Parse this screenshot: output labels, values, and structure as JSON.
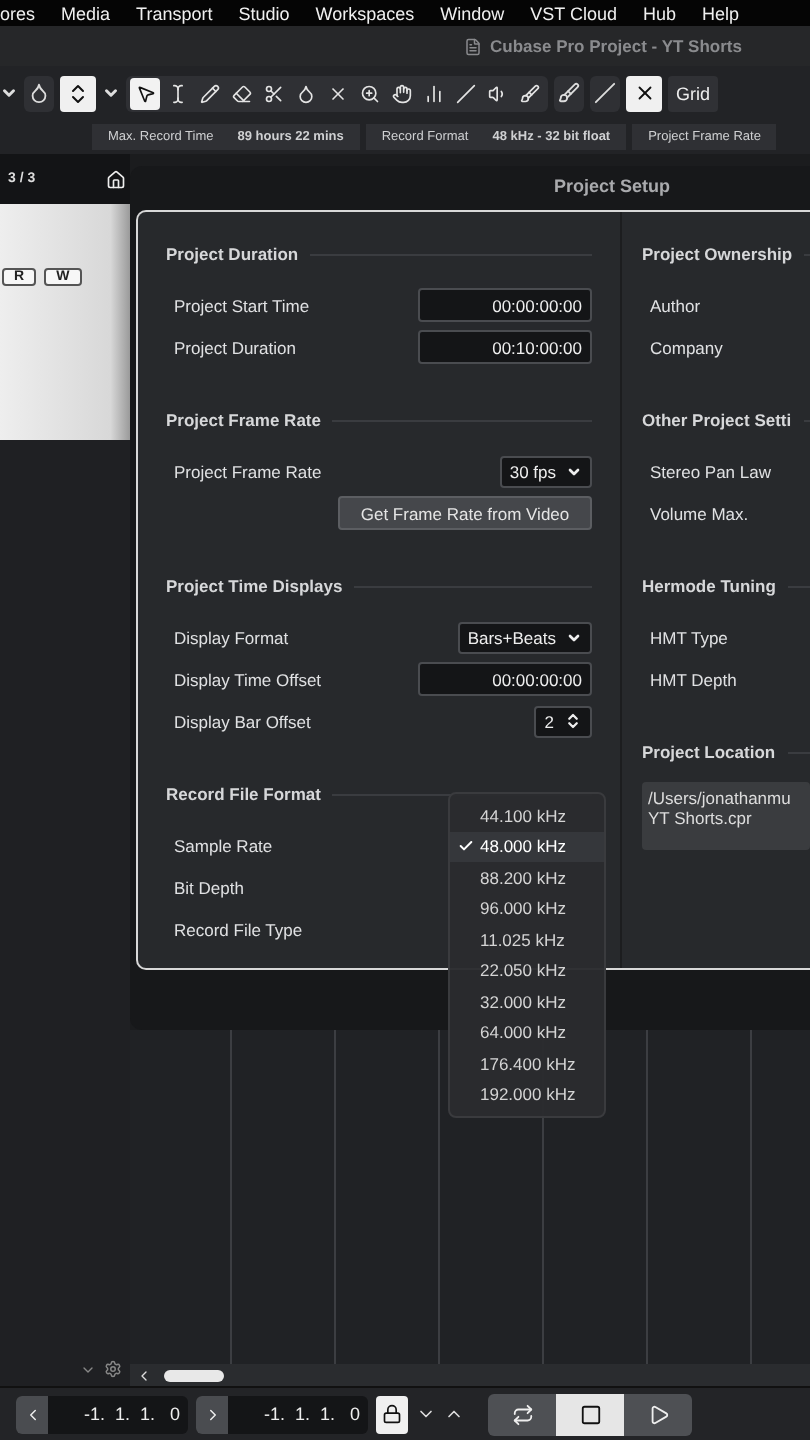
{
  "menu_bar": [
    "ores",
    "Media",
    "Transport",
    "Studio",
    "Workspaces",
    "Window",
    "VST Cloud",
    "Hub",
    "Help"
  ],
  "title_bar": {
    "title": "Cubase Pro Project - YT Shorts"
  },
  "toolbar": {
    "snap_label": "Grid",
    "tools": [
      {
        "selected": true
      },
      {
        "selected": false
      },
      {
        "selected": false
      },
      {
        "selected": false
      },
      {
        "selected": false
      },
      {
        "selected": false
      },
      {
        "selected": false
      },
      {
        "selected": false
      },
      {
        "selected": false
      },
      {
        "selected": false
      },
      {
        "selected": false
      },
      {
        "selected": false
      },
      {
        "selected": false
      }
    ]
  },
  "info_line": [
    {
      "label": "Max. Record Time",
      "value": "89 hours 22 mins"
    },
    {
      "label": "Record Format",
      "value": "48 kHz - 32 bit float"
    },
    {
      "label": "Project Frame Rate"
    }
  ],
  "track_list": {
    "counter": "3 / 3",
    "track_buttons": [
      "R",
      "W"
    ]
  },
  "dialog": {
    "title": "Project Setup",
    "left_sections": [
      {
        "heading": "Project Duration",
        "rows": [
          {
            "kind": "field",
            "label": "Project Start Time",
            "value": "00:00:00:00"
          },
          {
            "kind": "field",
            "label": "Project Duration",
            "value": "00:10:00:00"
          }
        ]
      },
      {
        "heading": "Project Frame Rate",
        "rows": [
          {
            "kind": "select",
            "label": "Project Frame Rate",
            "value": "30 fps"
          },
          {
            "kind": "button",
            "value": "Get Frame Rate from Video"
          }
        ]
      },
      {
        "heading": "Project Time Displays",
        "rows": [
          {
            "kind": "select",
            "label": "Display Format",
            "value": "Bars+Beats"
          },
          {
            "kind": "field",
            "label": "Display Time Offset",
            "value": "00:00:00:00"
          },
          {
            "kind": "spinner",
            "label": "Display Bar Offset",
            "value": "2"
          }
        ]
      },
      {
        "heading": "Record File Format",
        "rows": [
          {
            "kind": "label",
            "label": "Sample Rate"
          },
          {
            "kind": "label",
            "label": "Bit Depth"
          },
          {
            "kind": "label",
            "label": "Record File Type"
          }
        ]
      }
    ],
    "right_sections": [
      {
        "heading": "Project Ownership",
        "rows": [
          "Author",
          "Company"
        ]
      },
      {
        "heading": "Other Project Setti",
        "rows": [
          "Stereo Pan Law",
          "Volume Max."
        ]
      },
      {
        "heading": "Hermode Tuning",
        "rows": [
          "HMT Type",
          "HMT Depth"
        ]
      },
      {
        "heading": "Project Location",
        "path": [
          "/Users/jonathanmu",
          "YT Shorts.cpr"
        ]
      }
    ],
    "sample_rate_menu": [
      {
        "label": "44.100 kHz",
        "selected": false
      },
      {
        "label": "48.000 kHz",
        "selected": true
      },
      {
        "label": "88.200 kHz",
        "selected": false
      },
      {
        "label": "96.000 kHz",
        "selected": false
      },
      {
        "label": "11.025 kHz",
        "selected": false
      },
      {
        "label": "22.050 kHz",
        "selected": false
      },
      {
        "label": "32.000 kHz",
        "selected": false
      },
      {
        "label": "64.000 kHz",
        "selected": false
      },
      {
        "label": "176.400 kHz",
        "selected": false
      },
      {
        "label": "192.000 kHz",
        "selected": false
      }
    ]
  },
  "transport": {
    "left_locator": "-1.  1.  1.   0",
    "right_locator": "-1.  1.  1.   0",
    "lock_on": true,
    "buttons": [
      {
        "selected": false
      },
      {
        "selected": true
      },
      {
        "selected": false
      }
    ]
  }
}
